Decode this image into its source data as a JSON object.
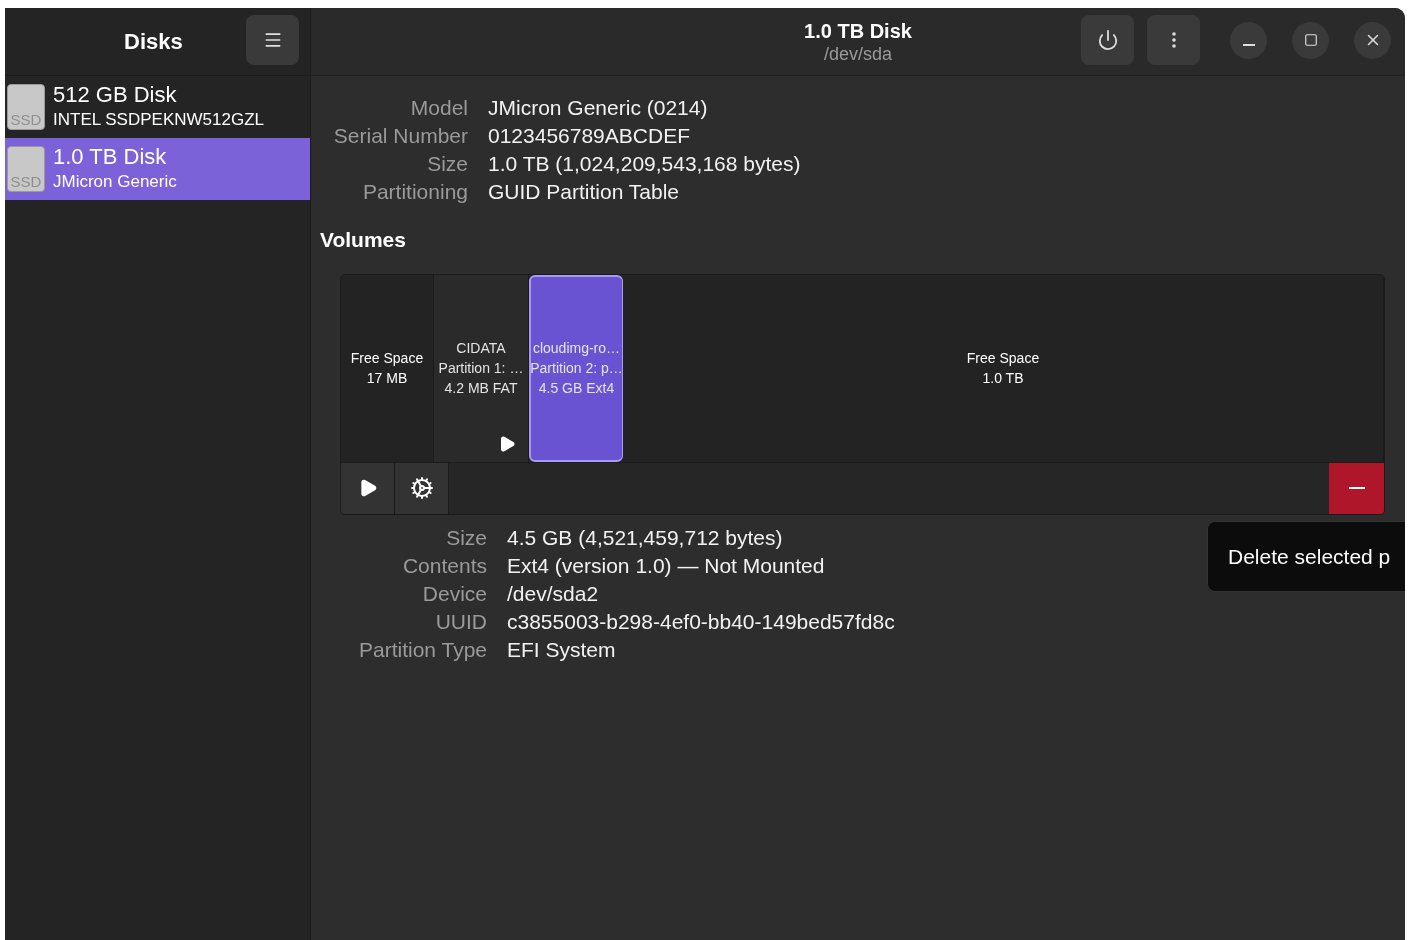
{
  "sidebar": {
    "title": "Disks",
    "disks": [
      {
        "name": "512 GB Disk",
        "model": "INTEL SSDPEKNW512GZL",
        "icon_label": "SSD",
        "selected": false
      },
      {
        "name": "1.0 TB Disk",
        "model": "JMicron Generic",
        "icon_label": "SSD",
        "selected": true
      }
    ]
  },
  "header": {
    "title": "1.0 TB Disk",
    "subtitle": "/dev/sda"
  },
  "disk_info": [
    {
      "label": "Model",
      "value": "JMicron Generic (0214)"
    },
    {
      "label": "Serial Number",
      "value": "0123456789ABCDEF"
    },
    {
      "label": "Size",
      "value": "1.0 TB (1,024,209,543,168 bytes)"
    },
    {
      "label": "Partitioning",
      "value": "GUID Partition Table"
    }
  ],
  "volumes": {
    "heading": "Volumes",
    "segments": [
      {
        "kind": "free",
        "lines": [
          "Free Space",
          "17 MB"
        ],
        "selected": false,
        "play_marker": false
      },
      {
        "kind": "partition",
        "lines": [
          "CIDATA",
          "Partition 1: …",
          "4.2 MB FAT"
        ],
        "selected": false,
        "play_marker": true
      },
      {
        "kind": "partition",
        "lines": [
          "cloudimg-ro…",
          "Partition 2: p…",
          "4.5 GB Ext4"
        ],
        "selected": true,
        "play_marker": false
      },
      {
        "kind": "free",
        "lines": [
          "Free Space",
          "1.0 TB"
        ],
        "selected": false,
        "play_marker": false
      }
    ],
    "tooltip": "Delete selected p"
  },
  "volume_info": [
    {
      "label": "Size",
      "value": "4.5 GB (4,521,459,712 bytes)"
    },
    {
      "label": "Contents",
      "value": "Ext4 (version 1.0) — Not Mounted"
    },
    {
      "label": "Device",
      "value": "/dev/sda2"
    },
    {
      "label": "UUID",
      "value": "c3855003-b298-4ef0-bb40-149bed57fd8c"
    },
    {
      "label": "Partition Type",
      "value": "EFI System"
    }
  ]
}
